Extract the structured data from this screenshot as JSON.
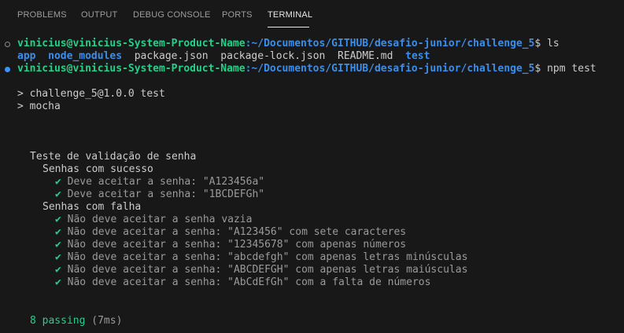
{
  "panel": {
    "tabs": [
      {
        "label": "PROBLEMS"
      },
      {
        "label": "OUTPUT"
      },
      {
        "label": "DEBUG CONSOLE"
      },
      {
        "label": "PORTS"
      },
      {
        "label": "TERMINAL"
      }
    ],
    "active_tab": "TERMINAL"
  },
  "terminal": {
    "prompt1": {
      "user_host": "vinicius@vinicius-System-Product-Name",
      "path": ":~/Documentos/GITHUB/desafio-junior/challenge_5",
      "symbol": "$",
      "command": " ls"
    },
    "ls_output": {
      "app": "app",
      "node_modules": "node_modules",
      "package_json": "package.json",
      "package_lock": "package-lock.json",
      "readme": "README.md",
      "test": "test"
    },
    "prompt2": {
      "user_host": "vinicius@vinicius-System-Product-Name",
      "path": ":~/Documentos/GITHUB/desafio-junior/challenge_5",
      "symbol": "$",
      "command": " npm test"
    },
    "npm_line1": "> challenge_5@1.0.0 test",
    "npm_line2": "> mocha",
    "suite_title": "Teste de validação de senha",
    "group1_title": "Senhas com sucesso",
    "group1_tests": [
      "Deve aceitar a senha: \"A123456a\"",
      "Deve aceitar a senha: \"1BCDEFGh\""
    ],
    "group2_title": "Senhas com falha",
    "group2_tests": [
      "Não deve aceitar a senha vazia",
      "Não deve aceitar a senha: \"A123456\" com sete caracteres",
      "Não deve aceitar a senha: \"12345678\" com apenas números",
      "Não deve aceitar a senha: \"abcdefgh\" com apenas letras minúsculas",
      "Não deve aceitar a senha: \"ABCDEFGH\" com apenas letras maiúsculas",
      "Não deve aceitar a senha: \"AbCdEfGh\" com a falta de números"
    ],
    "check_glyph": "✔",
    "passing_count": "8 passing",
    "passing_time": " (7ms)"
  },
  "colors": {
    "background": "#181818",
    "prompt_green": "#23d18b",
    "path_blue": "#3b8eea",
    "text": "#cccccc",
    "muted": "#9a9a9a"
  }
}
